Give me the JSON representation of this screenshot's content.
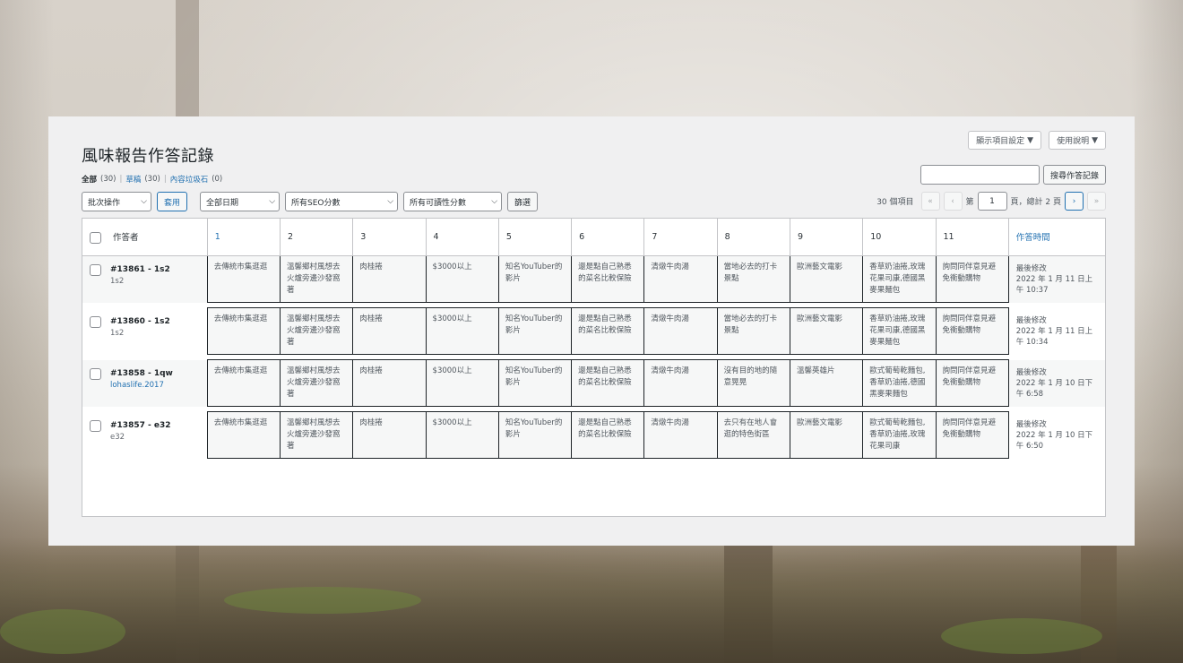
{
  "header": {
    "title": "風味報告作答記錄",
    "screen_options": "顯示項目設定",
    "help": "使用說明"
  },
  "filters_view": {
    "all_label": "全部",
    "all_count": "(30)",
    "draft_label": "草稿",
    "draft_count": "(30)",
    "trash_label": "內容垃圾石",
    "trash_count": "(0)"
  },
  "search": {
    "value": "",
    "button": "搜尋作答記錄"
  },
  "tablenav": {
    "bulk_action": "批次操作",
    "apply": "套用",
    "date_filter": "全部日期",
    "seo_filter": "所有SEO分數",
    "readability_filter": "所有可讀性分數",
    "filter_button": "篩選"
  },
  "pagination": {
    "items": "30 個項目",
    "first": "«",
    "prev": "‹",
    "page_prefix": "第",
    "current_page": "1",
    "page_suffix": "頁，總計 2 頁",
    "next": "›",
    "last": "»"
  },
  "table": {
    "columns": [
      "作答者",
      "1",
      "2",
      "3",
      "4",
      "5",
      "6",
      "7",
      "8",
      "9",
      "10",
      "11",
      "作答時間"
    ],
    "rows": [
      {
        "id": "#13861 - 1s2",
        "user": "1s2",
        "user_link": false,
        "answers": [
          "去傳統市集逛逛",
          "溫馨鄉村風想去火爐旁邊沙發窩著",
          "肉桂捲",
          "$3000以上",
          "知名YouTuber的影片",
          "還是點自己熟悉的菜名比較保險",
          "清燉牛肉湯",
          "當地必去的打卡景點",
          "歐洲藝文電影",
          "香草奶油捲,玫瑰花果司康,德國黑麥果麵包",
          "詢問同伴意見避免衝動購物"
        ],
        "time": [
          "最後修改",
          "2022 年 1 月 11 日上",
          "午 10:37"
        ]
      },
      {
        "id": "#13860 - 1s2",
        "user": "1s2",
        "user_link": false,
        "answers": [
          "去傳統市集逛逛",
          "溫馨鄉村風想去火爐旁邊沙發窩著",
          "肉桂捲",
          "$3000以上",
          "知名YouTuber的影片",
          "還是點自己熟悉的菜名比較保險",
          "清燉牛肉湯",
          "當地必去的打卡景點",
          "歐洲藝文電影",
          "香草奶油捲,玫瑰花果司康,德國黑麥果麵包",
          "詢問同伴意見避免衝動購物"
        ],
        "time": [
          "最後修改",
          "2022 年 1 月 11 日上",
          "午 10:34"
        ]
      },
      {
        "id": "#13858 - 1qw",
        "user": "lohaslife.2017",
        "user_link": true,
        "answers": [
          "去傳統市集逛逛",
          "溫馨鄉村風想去火爐旁邊沙發窩著",
          "肉桂捲",
          "$3000以上",
          "知名YouTuber的影片",
          "還是點自己熟悉的菜名比較保險",
          "清燉牛肉湯",
          "沒有目的地的隨意晃晃",
          "溫馨英雄片",
          "歐式葡萄乾麵包,香草奶油捲,德國黑麥果麵包",
          "詢問同伴意見避免衝動購物"
        ],
        "time": [
          "最後修改",
          "2022 年 1 月 10 日下",
          "午 6:58"
        ]
      },
      {
        "id": "#13857 - e32",
        "user": "e32",
        "user_link": false,
        "answers": [
          "去傳統市集逛逛",
          "溫馨鄉村風想去火爐旁邊沙發窩著",
          "肉桂捲",
          "$3000以上",
          "知名YouTuber的影片",
          "還是點自己熟悉的菜名比較保險",
          "清燉牛肉湯",
          "去只有在地人會逛的特色街區",
          "歐洲藝文電影",
          "歐式葡萄乾麵包,香草奶油捲,玫瑰花果司康",
          "詢問同伴意見避免衝動購物"
        ],
        "time": [
          "最後修改",
          "2022 年 1 月 10 日下",
          "午 6:50"
        ]
      }
    ]
  }
}
